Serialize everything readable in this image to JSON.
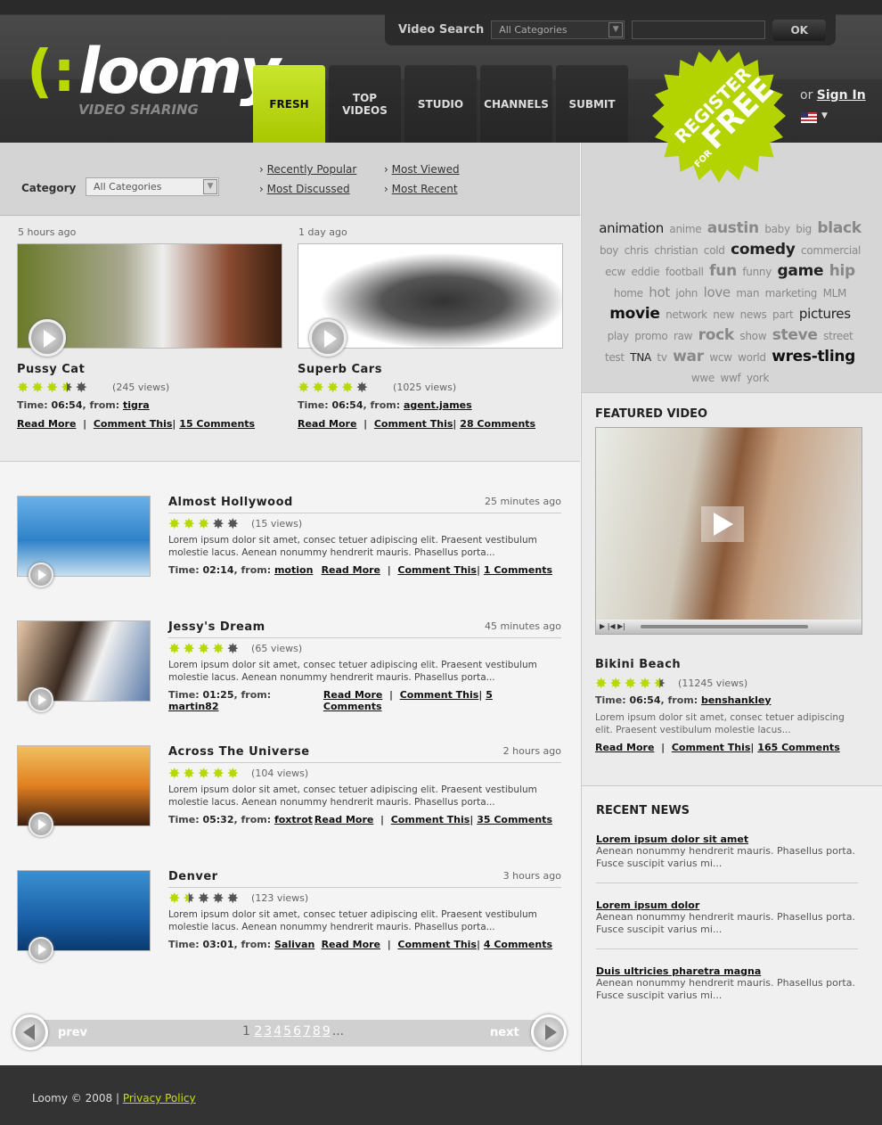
{
  "header": {
    "search_label": "Video Search",
    "search_category": "All Categories",
    "search_value": "",
    "ok_label": "OK",
    "logo_text": "loomy",
    "logo_tagline": "VIDEO SHARING",
    "nav": [
      {
        "label": "FRESH",
        "active": true
      },
      {
        "label": "TOP VIDEOS"
      },
      {
        "label": "STUDIO"
      },
      {
        "label": "CHANNELS"
      },
      {
        "label": "SUBMIT"
      }
    ],
    "badge": {
      "line1": "REGISTER",
      "line2": "FREE",
      "line3": "FOR"
    },
    "or": "or",
    "sign_in": "Sign In",
    "language_icon": "us-flag-icon"
  },
  "filter": {
    "label": "Category",
    "category": "All Categories",
    "links": [
      "Recently Popular",
      "Most Viewed",
      "Most Discussed",
      "Most Recent"
    ]
  },
  "featured_cards": [
    {
      "ago": "5 hours ago",
      "title": "Pussy Cat",
      "rating": 3.5,
      "views": "(245 views)",
      "time": "06:54",
      "from": "tigra",
      "comments": "15 Comments"
    },
    {
      "ago": "1 day ago",
      "title": "Superb Cars",
      "rating": 4,
      "views": "(1025 views)",
      "time": "06:54",
      "from": "agent.james",
      "comments": "28 Comments"
    }
  ],
  "labels": {
    "time": "Time:",
    "from": "from:",
    "read_more": "Read More",
    "comment_this": "Comment This",
    "sep": "|"
  },
  "videos": [
    {
      "title": "Almost Hollywood",
      "ago": "25 minutes ago",
      "rating": 3,
      "views": "(15 views)",
      "desc": "Lorem ipsum dolor sit amet, consec tetuer adipiscing elit. Praesent vestibulum molestie lacus. Aenean nonummy hendrerit mauris. Phasellus porta...",
      "time": "02:14",
      "from": "motion",
      "comments": "1 Comments"
    },
    {
      "title": "Jessy's Dream",
      "ago": "45 minutes ago",
      "rating": 4,
      "views": "(65 views)",
      "desc": "Lorem ipsum dolor sit amet, consec tetuer adipiscing elit. Praesent vestibulum molestie lacus. Aenean nonummy hendrerit mauris. Phasellus porta...",
      "time": "01:25",
      "from": "martin82",
      "comments": "5 Comments"
    },
    {
      "title": "Across The Universe",
      "ago": "2 hours ago",
      "rating": 5,
      "views": "(104 views)",
      "desc": "Lorem ipsum dolor sit amet, consec tetuer adipiscing elit. Praesent vestibulum molestie lacus. Aenean nonummy hendrerit mauris. Phasellus porta...",
      "time": "05:32",
      "from": "foxtrot",
      "comments": "35 Comments"
    },
    {
      "title": "Denver",
      "ago": "3 hours ago",
      "rating": 1.5,
      "views": "(123 views)",
      "desc": "Lorem ipsum dolor sit amet, consec tetuer adipiscing elit. Praesent vestibulum molestie lacus. Aenean nonummy hendrerit mauris. Phasellus porta...",
      "time": "03:01",
      "from": "Salivan",
      "comments": "4 Comments"
    }
  ],
  "pager": {
    "prev": "prev",
    "next": "next",
    "current": "1",
    "pages": [
      "2",
      "3",
      "4",
      "5",
      "6",
      "7",
      "8",
      "9"
    ],
    "more": "..."
  },
  "tags": [
    [
      "animation",
      2,
      "#222"
    ],
    [
      "anime",
      1,
      "#888"
    ],
    [
      "austin",
      3,
      "#888"
    ],
    [
      "baby",
      1,
      "#888"
    ],
    [
      "big",
      1,
      "#888"
    ],
    [
      "black",
      3,
      "#888"
    ],
    [
      "boy",
      1,
      "#888"
    ],
    [
      "chris",
      1,
      "#888"
    ],
    [
      "christian",
      1,
      "#888"
    ],
    [
      "cold",
      1,
      "#888"
    ],
    [
      "comedy",
      3,
      "#222"
    ],
    [
      "commercial",
      1,
      "#888"
    ],
    [
      "ecw",
      1,
      "#888"
    ],
    [
      "eddie",
      1,
      "#888"
    ],
    [
      "football",
      1,
      "#888"
    ],
    [
      "fun",
      3,
      "#888"
    ],
    [
      "funny",
      1,
      "#888"
    ],
    [
      "game",
      3,
      "#222"
    ],
    [
      "hip",
      3,
      "#888"
    ],
    [
      "home",
      1,
      "#888"
    ],
    [
      "hot",
      2,
      "#888"
    ],
    [
      "john",
      1,
      "#888"
    ],
    [
      "love",
      2,
      "#888"
    ],
    [
      "man",
      1,
      "#888"
    ],
    [
      "marketing",
      1,
      "#888"
    ],
    [
      "MLM",
      1,
      "#888"
    ],
    [
      "movie",
      3,
      "#111"
    ],
    [
      "network",
      1,
      "#888"
    ],
    [
      "new",
      1,
      "#888"
    ],
    [
      "news",
      1,
      "#888"
    ],
    [
      "part",
      1,
      "#888"
    ],
    [
      "pictures",
      2,
      "#222"
    ],
    [
      "play",
      1,
      "#888"
    ],
    [
      "promo",
      1,
      "#888"
    ],
    [
      "raw",
      1,
      "#888"
    ],
    [
      "rock",
      3,
      "#888"
    ],
    [
      "show",
      1,
      "#888"
    ],
    [
      "steve",
      3,
      "#888"
    ],
    [
      "street",
      1,
      "#888"
    ],
    [
      "test",
      1,
      "#888"
    ],
    [
      "TNA",
      1,
      "#222"
    ],
    [
      "tv",
      1,
      "#888"
    ],
    [
      "war",
      3,
      "#888"
    ],
    [
      "wcw",
      1,
      "#888"
    ],
    [
      "world",
      1,
      "#888"
    ],
    [
      "wres-tling",
      3,
      "#111"
    ],
    [
      "wwe",
      1,
      "#888"
    ],
    [
      "wwf",
      1,
      "#888"
    ],
    [
      "york",
      1,
      "#888"
    ]
  ],
  "featured_video": {
    "heading": "FEATURED VIDEO",
    "title": "Bikini Beach",
    "rating": 4.5,
    "views": "(11245 views)",
    "time": "06:54",
    "from": "benshankley",
    "desc": "Lorem ipsum dolor sit amet, consec tetuer adipiscing elit. Praesent vestibulum molestie lacus...",
    "comments": "165 Comments"
  },
  "news": {
    "heading": "RECENT NEWS",
    "items": [
      {
        "title": "Lorem ipsum dolor sit amet",
        "text": "Aenean nonummy hendrerit mauris. Phasellus porta. Fusce suscipit varius mi..."
      },
      {
        "title": "Lorem ipsum dolor",
        "text": "Aenean nonummy hendrerit mauris. Phasellus porta. Fusce suscipit varius mi..."
      },
      {
        "title": "Duis ultricies pharetra magna",
        "text": "Aenean nonummy hendrerit mauris. Phasellus porta. Fusce suscipit varius mi..."
      }
    ]
  },
  "footer": {
    "copyright": "Loomy © 2008",
    "sep": "|",
    "privacy": "Privacy Policy"
  },
  "colors": {
    "accent": "#b8d900",
    "header_bg": "#3a3a3a",
    "footer_bg": "#333333"
  }
}
